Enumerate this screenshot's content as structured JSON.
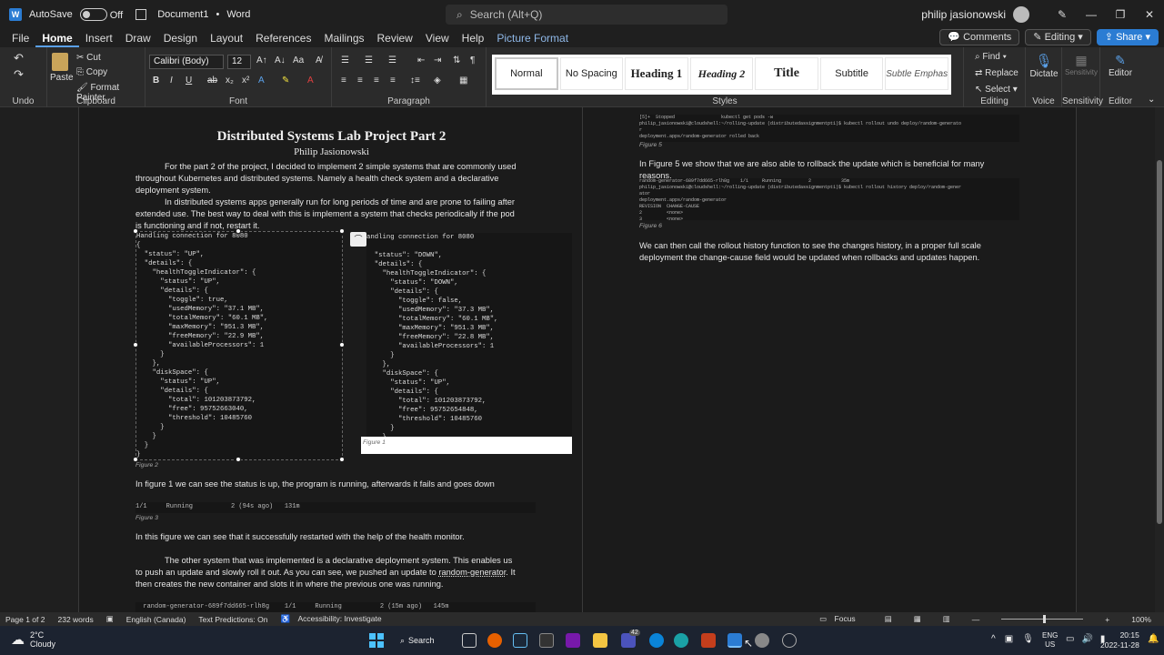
{
  "titlebar": {
    "autosave_label": "AutoSave",
    "autosave_state": "Off",
    "doc_name": "Document1",
    "app_name": "Word",
    "search_placeholder": "Search (Alt+Q)",
    "user_name": "philip jasionowski"
  },
  "menu": {
    "tabs": [
      "File",
      "Home",
      "Insert",
      "Draw",
      "Design",
      "Layout",
      "References",
      "Mailings",
      "Review",
      "View",
      "Help",
      "Picture Format"
    ],
    "active_tab": "Home",
    "comments_label": "Comments",
    "editing_label": "Editing",
    "share_label": "Share"
  },
  "ribbon": {
    "undo_label": "Undo",
    "paste_label": "Paste",
    "cut_label": "Cut",
    "copy_label": "Copy",
    "format_painter_label": "Format Painter",
    "clipboard_label": "Clipboard",
    "font_name": "Calibri (Body)",
    "font_size": "12",
    "font_label": "Font",
    "paragraph_label": "Paragraph",
    "styles": [
      "Normal",
      "No Spacing",
      "Heading 1",
      "Heading 2",
      "Title",
      "Subtitle",
      "Subtle Emphas"
    ],
    "selected_style": "Normal",
    "styles_label": "Styles",
    "find_label": "Find",
    "replace_label": "Replace",
    "select_label": "Select",
    "editing_group_label": "Editing",
    "dictate_label": "Dictate",
    "voice_label": "Voice",
    "sensitivity_btn": "Sensitivity",
    "sensitivity_label": "Sensitivity",
    "editor_btn": "Editor",
    "editor_label": "Editor"
  },
  "page1": {
    "title": "Distributed Systems Lab Project Part 2",
    "author": "Philip Jasionowski",
    "para1": "For the part 2 of the project, I decided to implement 2 simple systems that are commonly used throughout Kubernetes and distributed systems. Namely a health check system and a declarative deployment system.",
    "para2": "In distributed systems apps generally run for long periods of time and are prone to failing after extended use. The best way to deal with this is implement a system that checks periodically if the pod is functioning and if not, restart it.",
    "code_left": "Handling connection for 8080\n{\n  \"status\": \"UP\",\n  \"details\": {\n    \"healthToggleIndicator\": {\n      \"status\": \"UP\",\n      \"details\": {\n        \"toggle\": true,\n        \"usedMemory\": \"37.1 MB\",\n        \"totalMemory\": \"60.1 MB\",\n        \"maxMemory\": \"951.3 MB\",\n        \"freeMemory\": \"22.9 MB\",\n        \"availableProcessors\": 1\n      }\n    },\n    \"diskSpace\": {\n      \"status\": \"UP\",\n      \"details\": {\n        \"total\": 101203873792,\n        \"free\": 95752663040,\n        \"threshold\": 10485760\n      }\n    }\n  }\n}",
    "code_right": "andling connection for 8080\n\n  \"status\": \"DOWN\",\n  \"details\": {\n    \"healthToggleIndicator\": {\n      \"status\": \"DOWN\",\n      \"details\": {\n        \"toggle\": false,\n        \"usedMemory\": \"37.3 MB\",\n        \"totalMemory\": \"60.1 MB\",\n        \"maxMemory\": \"951.3 MB\",\n        \"freeMemory\": \"22.8 MB\",\n        \"availableProcessors\": 1\n      }\n    },\n    \"diskSpace\": {\n      \"status\": \"UP\",\n      \"details\": {\n        \"total\": 101203873792,\n        \"free\": 95752654848,\n        \"threshold\": 10485760\n      }\n    }\n  }\n}",
    "fig1": "Figure 1",
    "fig2": "Figure 2",
    "para3": "In figure 1 we can see the status is up, the program is running, afterwards it fails and goes down",
    "term_fig3": "1/1     Running          2 (94s ago)   131m",
    "fig3": "Figure 3",
    "para4": "In this figure we can see that it successfully restarted with the help of the health monitor.",
    "para5_a": "The other system that was implemented is a declarative deployment system. This enables us to push an update and slowly roll it out. As you can see, we pushed an update to ",
    "para5_link": "random-generator",
    "para5_b": ". It then creates the new container and slots it in where the previous one was running.",
    "term_bottom": "  random-generator-689f7dd665-rlh8g    1/1     Running          2 (15m ago)   145m"
  },
  "page2": {
    "term_fig5": "[5]+  Stopped                 kubectl get pods -w\nphilip_jasionowski@cloudshell:~/rolling-update (distributedassignmentpt1)$ kubectl rollout undo deploy/random-generato\nr\ndeployment.apps/random-generator rolled back",
    "fig5": "Figure 5",
    "para1": "In Figure 5 we show that we are also able to rollback the update which is beneficial for many reasons.",
    "term_fig6": "random-generator-689f7dd665-rlh8g    1/1     Running          2           35m\nphilip_jasionowski@cloudshell:~/rolling-update (distributedassignmentpt1)$ kubectl rollout history deploy/random-gener\nator\ndeployment.apps/random-generator\nREVISION  CHANGE-CAUSE\n2         <none>\n3         <none>",
    "fig6": "Figure 6",
    "para2": "We can then call the rollout history function to see the changes history, in a proper full scale deployment the change-cause field would be updated when rollbacks and updates happen."
  },
  "statusbar": {
    "page": "Page 1 of 2",
    "words": "232 words",
    "language": "English (Canada)",
    "text_predictions": "Text Predictions: On",
    "accessibility": "Accessibility: Investigate",
    "focus": "Focus",
    "zoom": "100%"
  },
  "taskbar": {
    "weather_temp": "2°C",
    "weather_text": "Cloudy",
    "search_label": "Search",
    "lang": "ENG",
    "region": "US",
    "time": "20:15",
    "date": "2022-11-28",
    "badge": "42"
  },
  "colors": {
    "accent": "#2b7cd3",
    "link": "#8fb8e8",
    "code_string": "#6a9955"
  }
}
